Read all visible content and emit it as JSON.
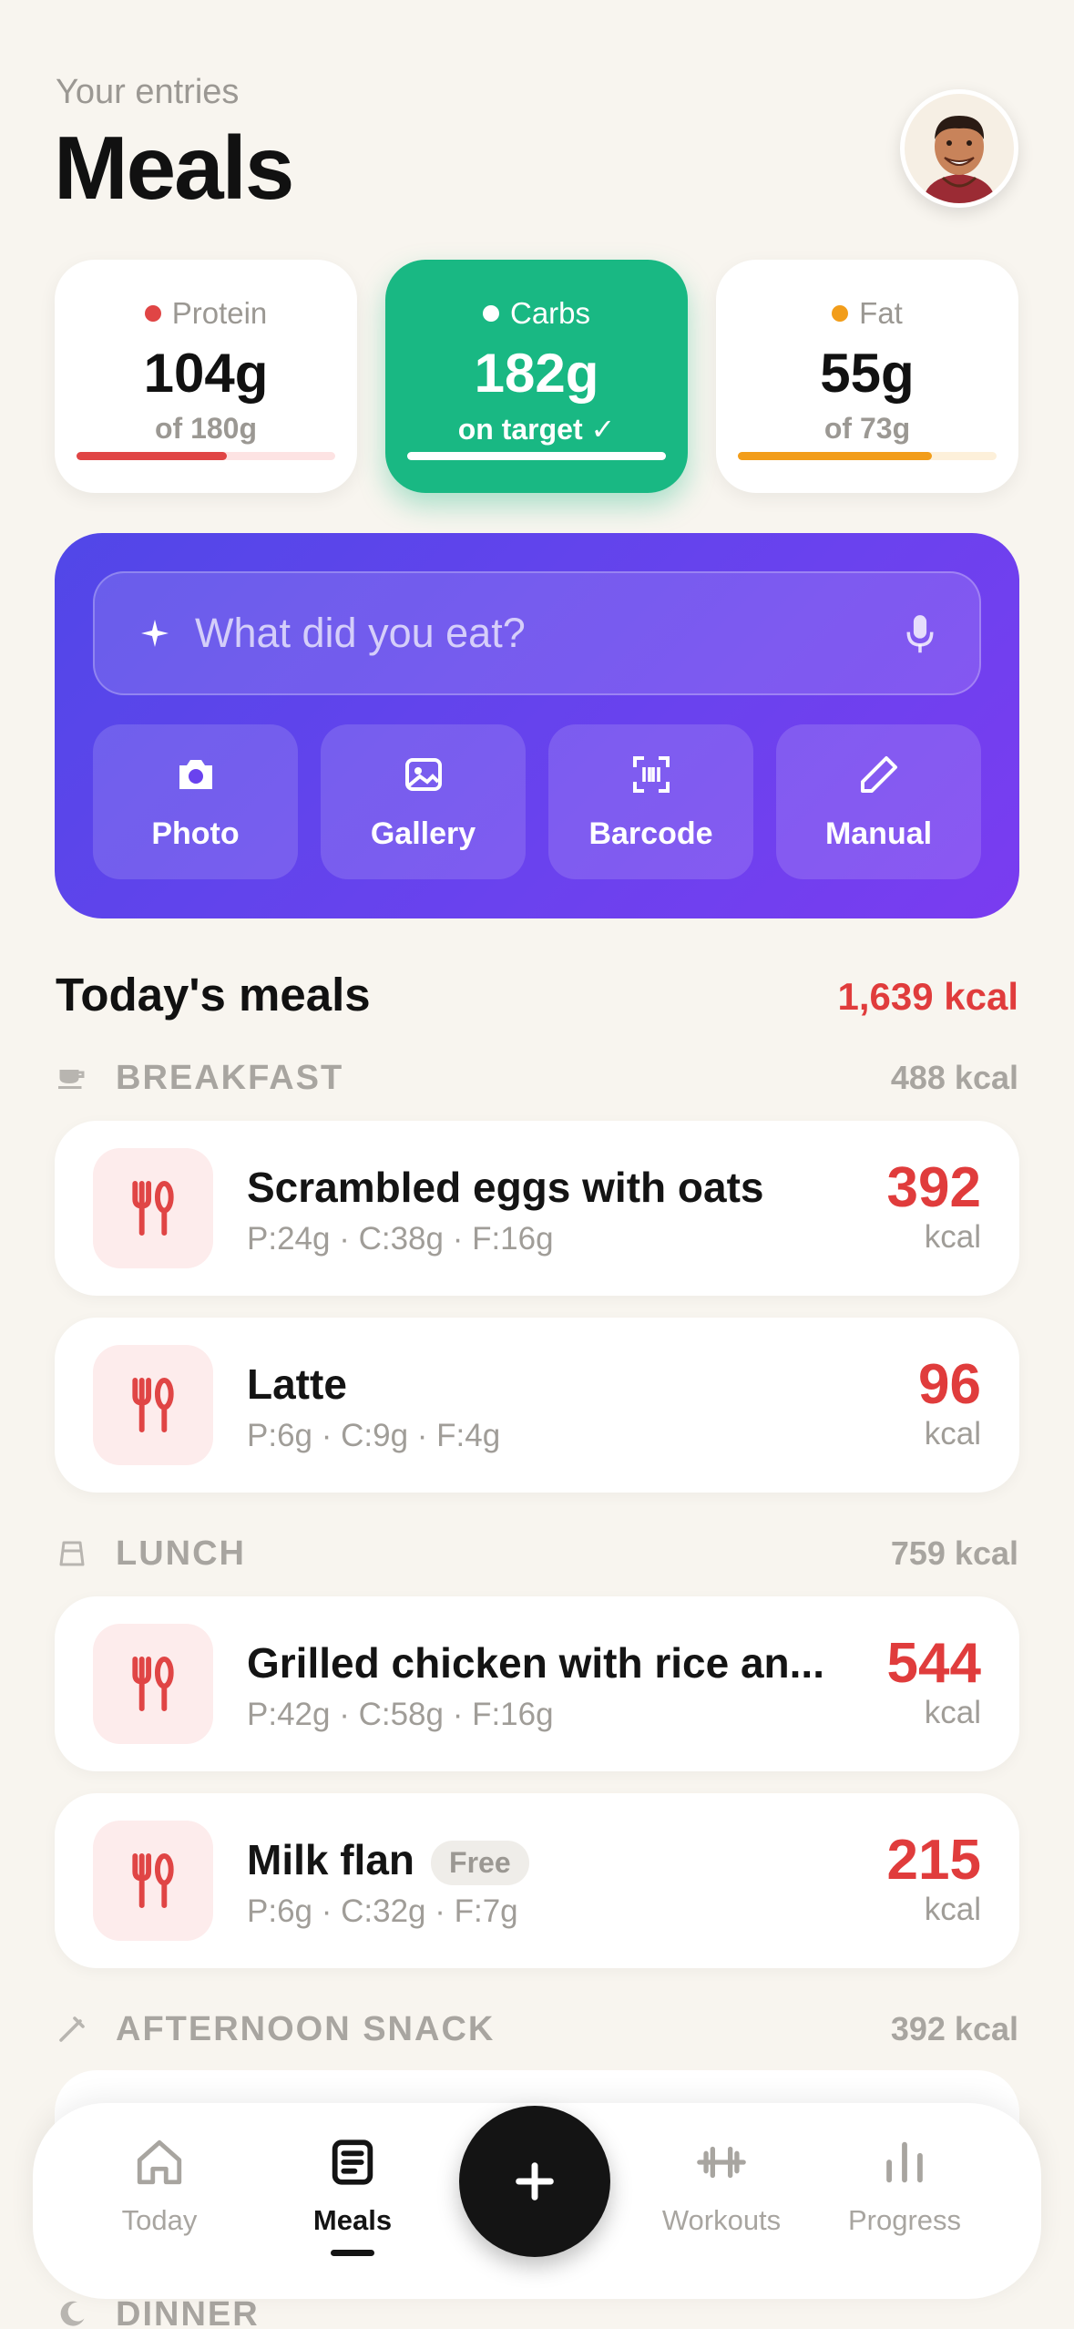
{
  "header": {
    "eyebrow": "Your entries",
    "title": "Meals"
  },
  "macros": [
    {
      "label": "Protein",
      "value": "104g",
      "sub": "of 180g",
      "color": "#e04545",
      "progress": 0.58
    },
    {
      "label": "Carbs",
      "value": "182g",
      "sub": "on target ✓",
      "color": "#ffffff",
      "progress": 1.0,
      "active": true
    },
    {
      "label": "Fat",
      "value": "55g",
      "sub": "of 73g",
      "color": "#f29d1a",
      "progress": 0.75
    }
  ],
  "logger": {
    "placeholder": "What did you eat?",
    "actions": [
      {
        "label": "Photo",
        "icon": "camera-icon"
      },
      {
        "label": "Gallery",
        "icon": "image-icon"
      },
      {
        "label": "Barcode",
        "icon": "barcode-icon"
      },
      {
        "label": "Manual",
        "icon": "pencil-icon"
      }
    ]
  },
  "today": {
    "title": "Today's meals",
    "total": "1,639 kcal"
  },
  "groups": {
    "breakfast": {
      "name": "BREAKFAST",
      "total": "488 kcal",
      "icon": "cup-icon"
    },
    "lunch": {
      "name": "LUNCH",
      "total": "759 kcal",
      "icon": "lunchbox-icon"
    },
    "snack": {
      "name": "AFTERNOON SNACK",
      "total": "392 kcal",
      "icon": "snack-icon"
    },
    "dinner": {
      "name": "DINNER",
      "icon": "moon-icon"
    }
  },
  "meals": [
    {
      "name": "Scrambled eggs with oats",
      "macros": "P:24g · C:38g · F:16g",
      "kcal": "392",
      "unit": "kcal"
    },
    {
      "name": "Latte",
      "macros": "P:6g · C:9g · F:4g",
      "kcal": "96",
      "unit": "kcal"
    },
    {
      "name": "Grilled chicken with rice an...",
      "macros": "P:42g · C:58g · F:16g",
      "kcal": "544",
      "unit": "kcal"
    },
    {
      "name": "Milk flan",
      "badge": "Free",
      "macros": "P:6g · C:32g · F:7g",
      "kcal": "215",
      "unit": "kcal"
    }
  ],
  "nav": {
    "items": [
      {
        "label": "Today",
        "icon": "home-icon"
      },
      {
        "label": "Meals",
        "icon": "document-icon",
        "active": true
      },
      {
        "label": "Workouts",
        "icon": "dumbbell-icon"
      },
      {
        "label": "Progress",
        "icon": "bar-chart-icon"
      }
    ],
    "fab_icon": "plus-icon"
  },
  "colors": {
    "accent": "#19b883",
    "brand_purple": "#5f45ec",
    "kcal_red": "#e03c3c",
    "background": "#f8f5ef"
  }
}
